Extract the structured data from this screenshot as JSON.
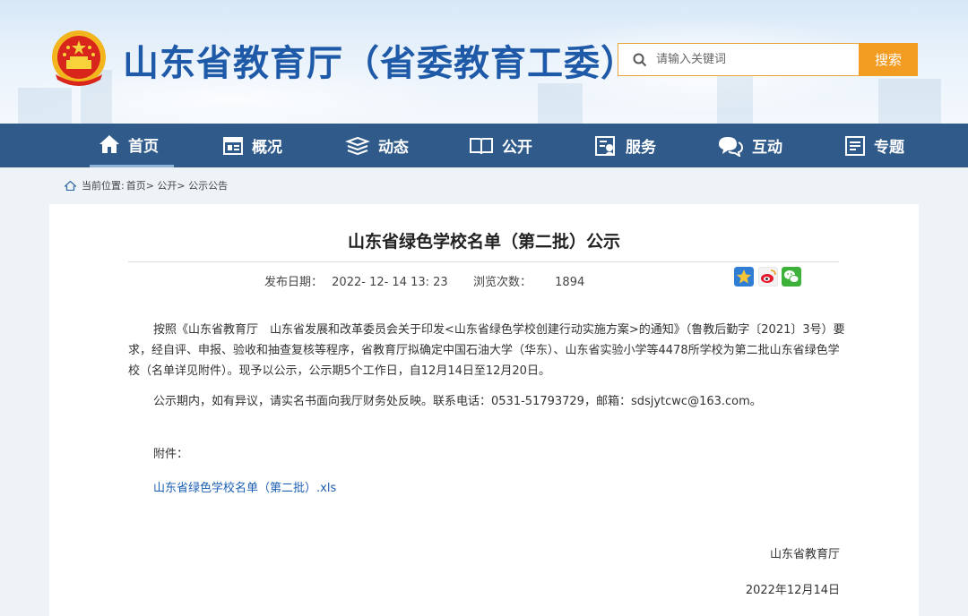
{
  "header": {
    "site_title": "山东省教育厅（省委教育工委）",
    "search_placeholder": "请输入关键词",
    "search_button": "搜索"
  },
  "nav": [
    {
      "label": "首页",
      "icon": "home-icon"
    },
    {
      "label": "概况",
      "icon": "overview-icon"
    },
    {
      "label": "动态",
      "icon": "news-stack-icon"
    },
    {
      "label": "公开",
      "icon": "book-icon"
    },
    {
      "label": "服务",
      "icon": "service-icon"
    },
    {
      "label": "互动",
      "icon": "chat-icon"
    },
    {
      "label": "专题",
      "icon": "topic-icon"
    }
  ],
  "breadcrumb": {
    "prefix": "当前位置:",
    "path": "首页> 公开> 公示公告"
  },
  "article": {
    "title": "山东省绿色学校名单（第二批）公示",
    "publish_label": "发布日期：",
    "publish_date": "2022- 12- 14 13: 23",
    "views_label": "浏览次数：",
    "views": "1894",
    "share_icons": [
      "qzone-icon",
      "weibo-icon",
      "wechat-icon"
    ],
    "para1": "按照《山东省教育厅　山东省发展和改革委员会关于印发<山东省绿色学校创建行动实施方案>的通知》（鲁教后勤字〔2021〕3号）要求，经自评、申报、验收和抽查复核等程序，省教育厅拟确定中国石油大学（华东）、山东省实验小学等4478所学校为第二批山东省绿色学校（名单详见附件）。现予以公示，公示期5个工作日，自12月14日至12月20日。",
    "para2": "公示期内，如有异议，请实名书面向我厅财务处反映。联系电话：0531-51793729，邮箱：sdsjytcwc@163.com。",
    "attachment_label": "附件：",
    "attachment_link": "山东省绿色学校名单（第二批）.xls",
    "signature": "山东省教育厅",
    "sign_date": "2022年12月14日"
  },
  "colors": {
    "brand_blue": "#1e5aa7",
    "nav_bg": "#2f5a89",
    "search_orange": "#f39c22",
    "link_blue": "#1b5fb4"
  }
}
